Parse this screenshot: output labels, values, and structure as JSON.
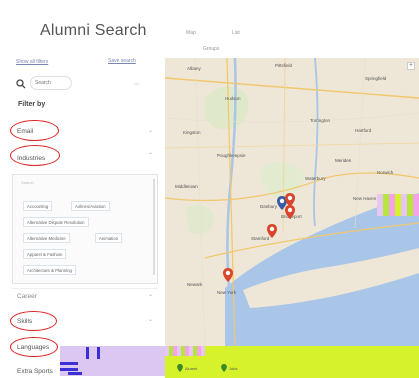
{
  "header": {
    "title": "Alumni Search",
    "links": [
      "Map",
      "List",
      "Groups"
    ]
  },
  "sidebar": {
    "show_all": "Show all filters",
    "save_search": "Save search",
    "search_placeholder": "Search",
    "search_hint": "Go",
    "filter_by": "Filter by",
    "filters": [
      {
        "label": "Email"
      },
      {
        "label": "Industries"
      },
      {
        "label": "Career"
      },
      {
        "label": "Skills"
      },
      {
        "label": "Languages"
      },
      {
        "label": "Extra Sports"
      }
    ],
    "industries": {
      "search_placeholder": "Search",
      "chips": [
        "Accounting",
        "Airlines/Aviation",
        "Alternative Dispute Resolution",
        "Alternative Medicine",
        "Animation",
        "Apparel & Fashion",
        "Architecture & Planning"
      ]
    }
  },
  "map": {
    "labels": {
      "albany": "Albany",
      "pittsfield": "Pittsfield",
      "poughkeepsie": "Poughkeepsie",
      "hartford": "Hartford",
      "waterbury": "Waterbury",
      "newhaven": "New Haven",
      "danbury": "Danbury",
      "stamford": "Stamford",
      "bridgeport": "Bridgeport",
      "newyork": "New York",
      "middletown": "Middletown",
      "kingston": "Kingston",
      "hudson": "Hudson",
      "springfield": "Springfield",
      "torrington": "Torrington",
      "meriden": "Meriden",
      "newark": "Newark",
      "norwich": "Norwich"
    },
    "legend": [
      "Alumni",
      "Jobs"
    ],
    "colors": {
      "land": "#eee6d6",
      "water": "#a9c6e8",
      "pin": "#d9452b",
      "pin_blue": "#3a5ba8",
      "accent_bar": "#d6f22a"
    }
  }
}
